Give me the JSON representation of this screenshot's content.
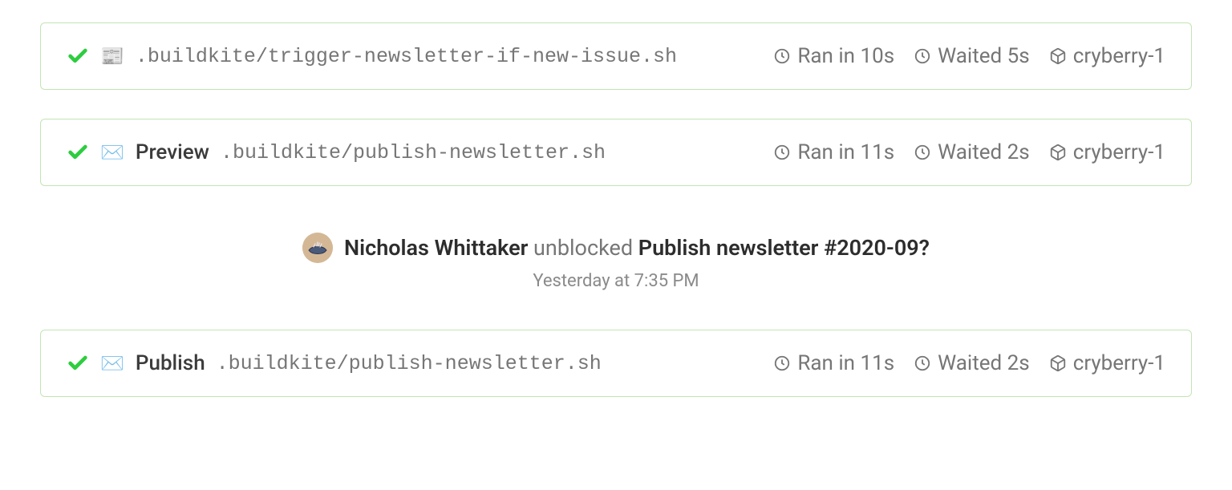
{
  "steps": [
    {
      "emoji": "📰",
      "name": "",
      "command": ".buildkite/trigger-newsletter-if-new-issue.sh",
      "ran": "Ran in 10s",
      "waited": "Waited 5s",
      "agent": "cryberry-1"
    },
    {
      "emoji": "✉️",
      "name": "Preview",
      "command": ".buildkite/publish-newsletter.sh",
      "ran": "Ran in 11s",
      "waited": "Waited 2s",
      "agent": "cryberry-1"
    },
    {
      "emoji": "✉️",
      "name": "Publish",
      "command": ".buildkite/publish-newsletter.sh",
      "ran": "Ran in 11s",
      "waited": "Waited 2s",
      "agent": "cryberry-1"
    }
  ],
  "unblock": {
    "actor": "Nicholas Whittaker",
    "verb": "unblocked",
    "target": "Publish newsletter #2020-09?",
    "timestamp": "Yesterday at 7:35 PM"
  }
}
